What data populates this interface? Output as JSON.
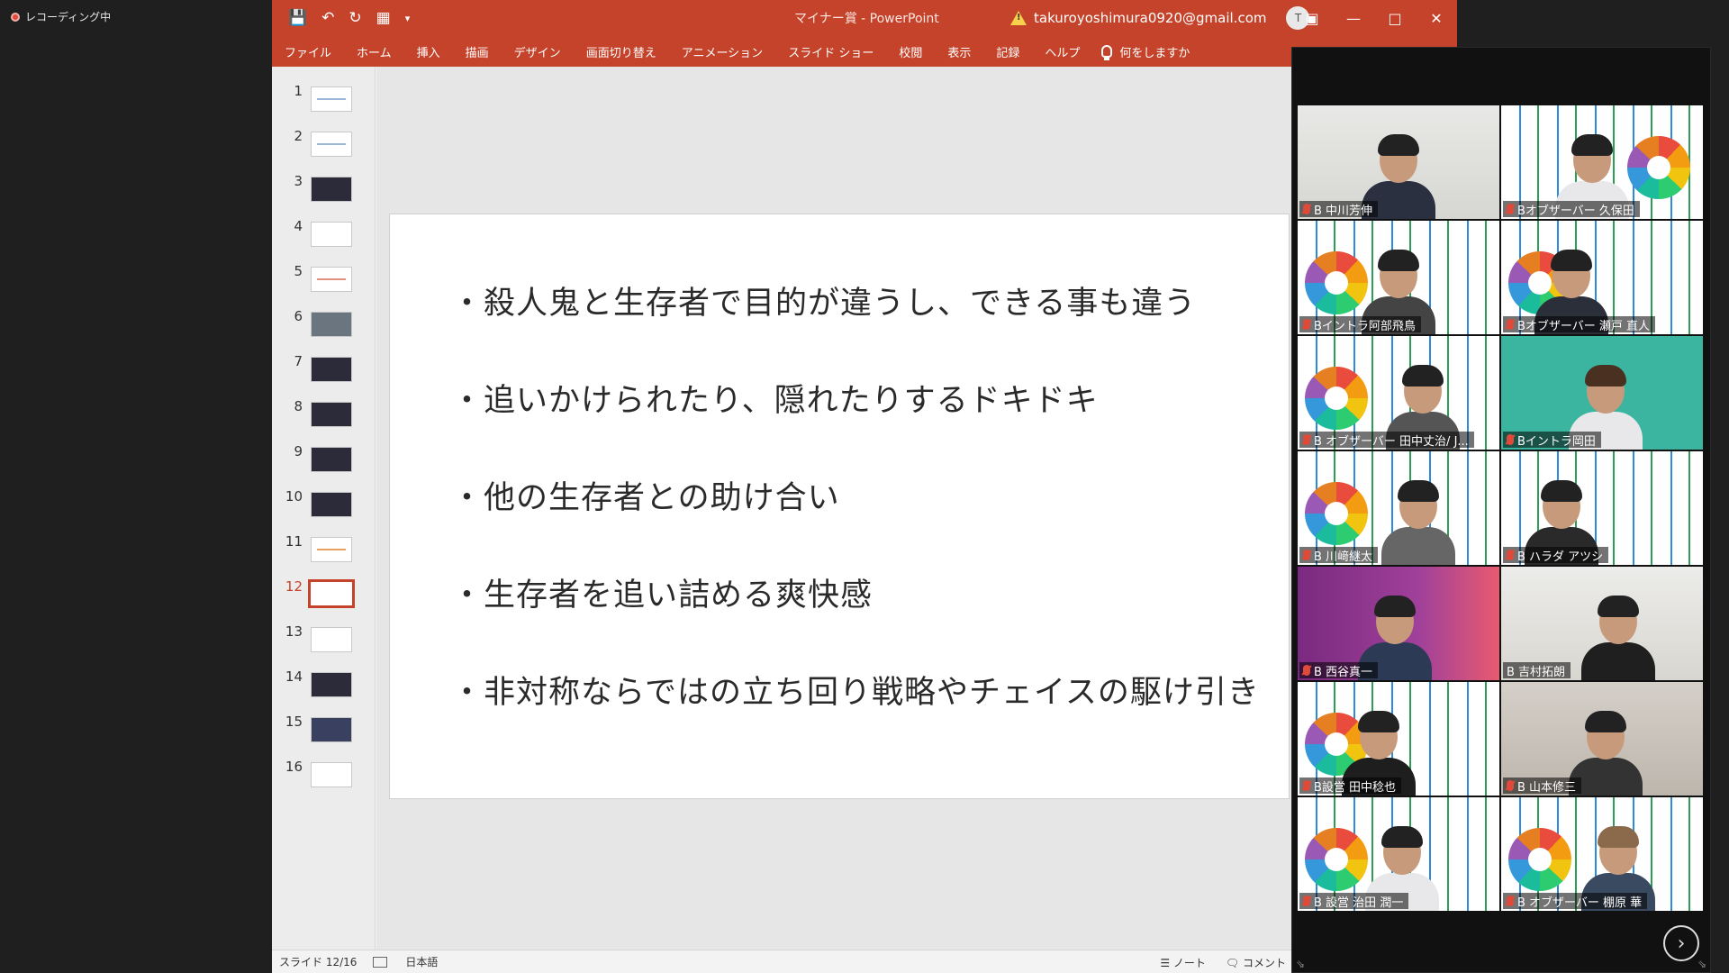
{
  "recording": {
    "label": "レコーディング中"
  },
  "powerpoint": {
    "title": "マイナー賞  -  PowerPoint",
    "account_email": "takuroyoshimura0920@gmail.com",
    "avatar_initial": "T",
    "menu": [
      "ファイル",
      "ホーム",
      "挿入",
      "描画",
      "デザイン",
      "画面切り替え",
      "アニメーション",
      "スライド ショー",
      "校閲",
      "表示",
      "記録",
      "ヘルプ"
    ],
    "tell_me": "何をしますか",
    "thumbnails": [
      "1",
      "2",
      "3",
      "4",
      "5",
      "6",
      "7",
      "8",
      "9",
      "10",
      "11",
      "12",
      "13",
      "14",
      "15",
      "16"
    ],
    "selected_slide": "12",
    "slide_bullets": [
      "・殺人鬼と生存者で目的が違うし、できる事も違う",
      "・追いかけられたり、隠れたりするドキドキ",
      "・他の生存者との助け合い",
      "・生存者を追い詰める爽快感",
      "・非対称ならではの立ち回り戦略やチェイスの駆け引き"
    ],
    "status": {
      "slide_indicator": "スライド 12/16",
      "language": "日本語",
      "notes": "ノート",
      "comments": "コメント"
    }
  },
  "conference": {
    "participants": [
      {
        "name": "B 中川芳伸"
      },
      {
        "name": "Bオブザーバー 久保田"
      },
      {
        "name": "Bイントラ阿部飛鳥"
      },
      {
        "name": "Bオブザーバー 瀬戸 直人"
      },
      {
        "name": "B オブザーバー 田中丈治/ J..."
      },
      {
        "name": "Bイントラ岡田"
      },
      {
        "name": "B 川﨑継太"
      },
      {
        "name": "B ハラダ アツシ"
      },
      {
        "name": "B 西谷真一"
      },
      {
        "name": "B 吉村拓朗"
      },
      {
        "name": "B設営 田中稔也"
      },
      {
        "name": "B 山本修三"
      },
      {
        "name": "B 設営 治田 潤一"
      },
      {
        "name": "B オブザーバー 棚原 華"
      }
    ]
  }
}
